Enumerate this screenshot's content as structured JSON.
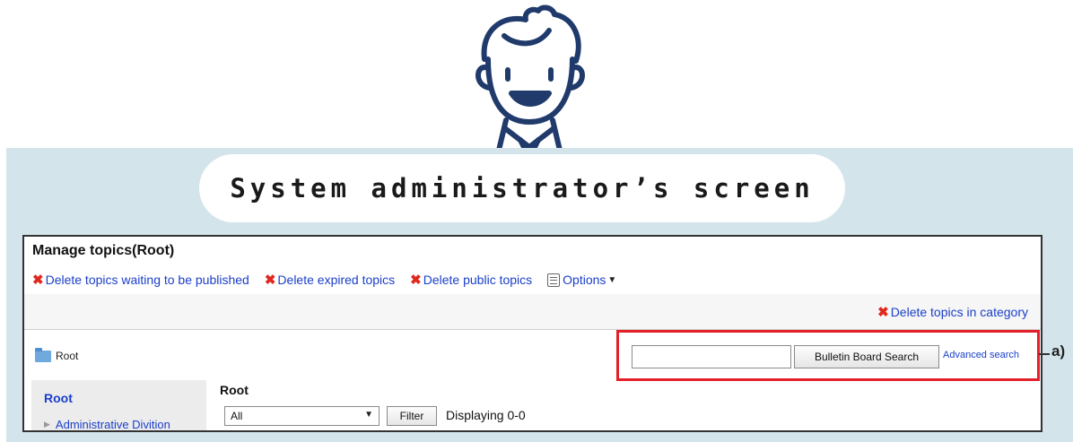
{
  "banner": {
    "title": "System administrator’s screen"
  },
  "screen": {
    "page_title": "Manage topics(Root)",
    "toolbar": {
      "delete_waiting": "Delete topics waiting to be published",
      "delete_expired": "Delete expired topics",
      "delete_public": "Delete public topics",
      "options": "Options"
    },
    "delete_in_category": "Delete topics in category",
    "breadcrumb": "Root",
    "search": {
      "input_value": "",
      "button_label": "Bulletin Board Search",
      "advanced_link": "Advanced search"
    },
    "callout_label": "a)",
    "sidebar": {
      "root_label": "Root",
      "items": [
        {
          "label": "Administrative Divition"
        }
      ]
    },
    "main": {
      "heading": "Root",
      "filter_selected": "All",
      "filter_button": "Filter",
      "displaying": "Displaying 0-0"
    }
  },
  "colors": {
    "backdrop": "#d3e5eb",
    "link": "#1a3fc9",
    "delete_icon": "#e0281e",
    "highlight_box": "#e3202a",
    "illustration_stroke": "#1f3a6b"
  },
  "icons": [
    "admin-avatar-icon",
    "delete-x-icon",
    "options-list-icon",
    "caret-down-icon",
    "folder-icon",
    "tree-expand-icon"
  ]
}
